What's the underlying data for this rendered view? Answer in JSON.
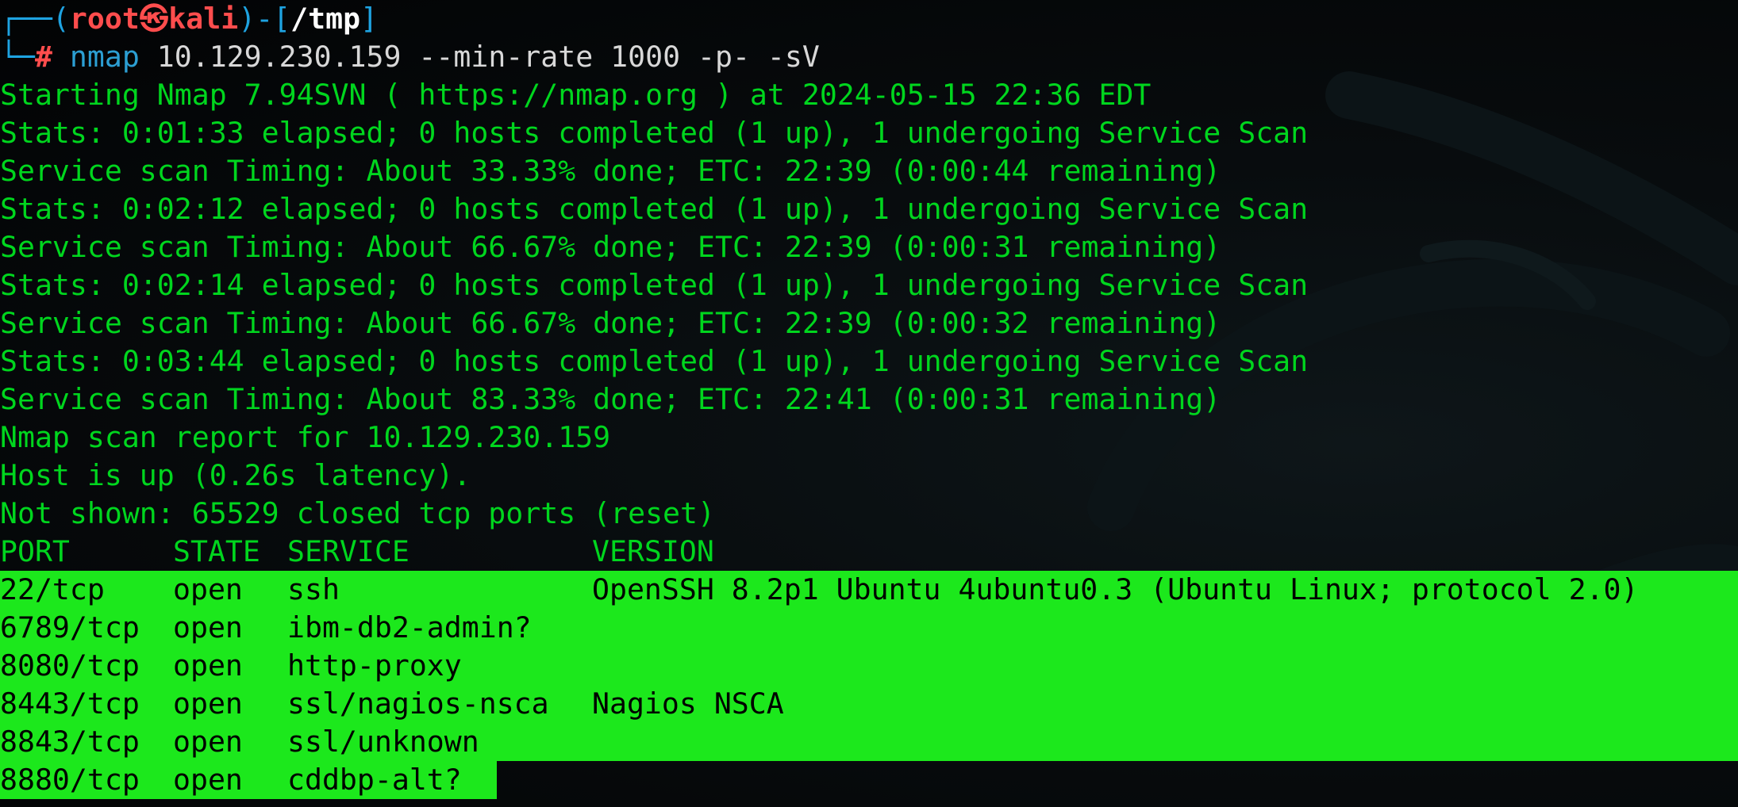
{
  "prompt": {
    "corner_top": "┌──(",
    "user": "root㉿kali",
    "mid": ")-[",
    "path": "/tmp",
    "end": "]",
    "corner_bottom": "└─",
    "symbol": "#"
  },
  "command": {
    "program": "nmap",
    "arguments": " 10.129.230.159 --min-rate 1000 -p- -sV"
  },
  "output": [
    "Starting Nmap 7.94SVN ( https://nmap.org ) at 2024-05-15 22:36 EDT",
    "Stats: 0:01:33 elapsed; 0 hosts completed (1 up), 1 undergoing Service Scan",
    "Service scan Timing: About 33.33% done; ETC: 22:39 (0:00:44 remaining)",
    "Stats: 0:02:12 elapsed; 0 hosts completed (1 up), 1 undergoing Service Scan",
    "Service scan Timing: About 66.67% done; ETC: 22:39 (0:00:31 remaining)",
    "Stats: 0:02:14 elapsed; 0 hosts completed (1 up), 1 undergoing Service Scan",
    "Service scan Timing: About 66.67% done; ETC: 22:39 (0:00:32 remaining)",
    "Stats: 0:03:44 elapsed; 0 hosts completed (1 up), 1 undergoing Service Scan",
    "Service scan Timing: About 83.33% done; ETC: 22:41 (0:00:31 remaining)",
    "Nmap scan report for 10.129.230.159",
    "Host is up (0.26s latency).",
    "Not shown: 65529 closed tcp ports (reset)"
  ],
  "table": {
    "headers": [
      "PORT",
      "STATE",
      "SERVICE",
      "VERSION"
    ],
    "rows": [
      [
        "22/tcp",
        "open",
        "ssh",
        "OpenSSH 8.2p1 Ubuntu 4ubuntu0.3 (Ubuntu Linux; protocol 2.0)"
      ],
      [
        "6789/tcp",
        "open",
        "ibm-db2-admin?",
        ""
      ],
      [
        "8080/tcp",
        "open",
        "http-proxy",
        ""
      ],
      [
        "8443/tcp",
        "open",
        "ssl/nagios-nsca",
        "Nagios NSCA"
      ],
      [
        "8843/tcp",
        "open",
        "ssl/unknown",
        ""
      ],
      [
        "8880/tcp",
        "open",
        "cddbp-alt?",
        ""
      ]
    ]
  },
  "colors": {
    "output_text": "#00d61e",
    "selection_highlight": "#1ce81c",
    "prompt_user": "#ff4d4d",
    "prompt_frame": "#1ea3e1",
    "background": "#05080a"
  }
}
